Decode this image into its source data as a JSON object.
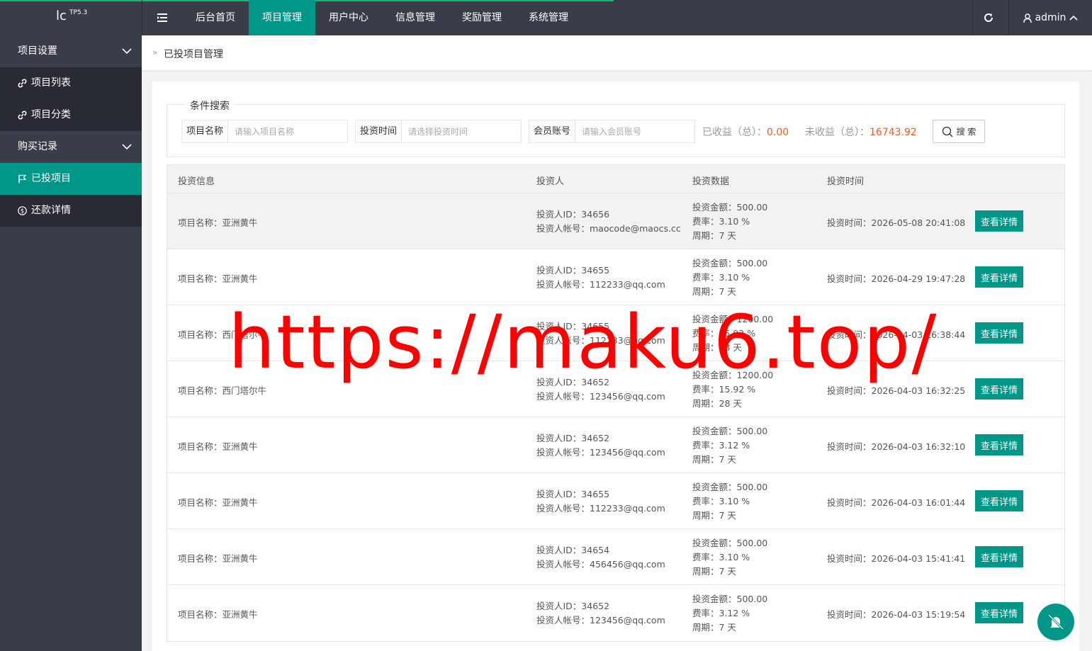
{
  "logo": {
    "text": "lc",
    "version": "TP5.3"
  },
  "nav": {
    "items": [
      "后台首页",
      "项目管理",
      "用户中心",
      "信息管理",
      "奖励管理",
      "系统管理"
    ],
    "active_index": 1
  },
  "user": {
    "name": "admin"
  },
  "sidebar": {
    "groups": [
      {
        "label": "项目设置",
        "items": [
          "项目列表",
          "项目分类"
        ]
      },
      {
        "label": "购买记录",
        "items": [
          "已投项目",
          "还款详情"
        ]
      }
    ],
    "active_item": "已投项目"
  },
  "breadcrumb": {
    "current": "已投项目管理"
  },
  "search": {
    "legend": "条件搜索",
    "name_label": "项目名称",
    "name_placeholder": "请输入项目名称",
    "time_label": "投资时间",
    "time_placeholder": "请选择投资时间",
    "member_label": "会员账号",
    "member_placeholder": "请输入会员账号",
    "earned_label": "已收益（总）：",
    "earned_value": "0.00",
    "unearned_label": "未收益（总）：",
    "unearned_value": "16743.92",
    "button_label": "搜 索"
  },
  "table": {
    "headers": [
      "投资信息",
      "投资人",
      "投资数据",
      "投资时间"
    ],
    "detail_label": "查看详情",
    "rows": [
      {
        "project": "项目名称：亚洲黄牛",
        "uid": "投资人ID：34656",
        "account": "投资人帐号：maocode@maocs.cc",
        "amount": "投资金额：500.00",
        "rate": "费率：3.10 %",
        "period": "周期：7 天",
        "time": "投资时间：2026-05-08 20:41:08"
      },
      {
        "project": "项目名称：亚洲黄牛",
        "uid": "投资人ID：34655",
        "account": "投资人帐号：112233@qq.com",
        "amount": "投资金额：500.00",
        "rate": "费率：3.10 %",
        "period": "周期：7 天",
        "time": "投资时间：2026-04-29 19:47:28"
      },
      {
        "project": "项目名称：西门塔尔牛",
        "uid": "投资人ID：34655",
        "account": "投资人帐号：112233@qq.com",
        "amount": "投资金额：1200.00",
        "rate": "费率：15.92 %",
        "period": "周期：28 天",
        "time": "投资时间：2026-04-03 16:38:44"
      },
      {
        "project": "项目名称：西门塔尔牛",
        "uid": "投资人ID：34652",
        "account": "投资人帐号：123456@qq.com",
        "amount": "投资金额：1200.00",
        "rate": "费率：15.92 %",
        "period": "周期：28 天",
        "time": "投资时间：2026-04-03 16:32:25"
      },
      {
        "project": "项目名称：亚洲黄牛",
        "uid": "投资人ID：34652",
        "account": "投资人帐号：123456@qq.com",
        "amount": "投资金额：500.00",
        "rate": "费率：3.12 %",
        "period": "周期：7 天",
        "time": "投资时间：2026-04-03 16:32:10"
      },
      {
        "project": "项目名称：亚洲黄牛",
        "uid": "投资人ID：34655",
        "account": "投资人帐号：112233@qq.com",
        "amount": "投资金额：500.00",
        "rate": "费率：3.10 %",
        "period": "周期：7 天",
        "time": "投资时间：2026-04-03 16:01:44"
      },
      {
        "project": "项目名称：亚洲黄牛",
        "uid": "投资人ID：34654",
        "account": "投资人帐号：456456@qq.com",
        "amount": "投资金额：500.00",
        "rate": "费率：3.10 %",
        "period": "周期：7 天",
        "time": "投资时间：2026-04-03 15:41:41"
      },
      {
        "project": "项目名称：亚洲黄牛",
        "uid": "投资人ID：34652",
        "account": "投资人帐号：123456@qq.com",
        "amount": "投资金额：500.00",
        "rate": "费率：3.12 %",
        "period": "周期：7 天",
        "time": "投资时间：2026-04-03 15:19:54"
      }
    ]
  },
  "watermark": "https://maku6.top/",
  "colors": {
    "accent": "#009688",
    "dark": "#393d49",
    "warn": "#ff5722"
  }
}
